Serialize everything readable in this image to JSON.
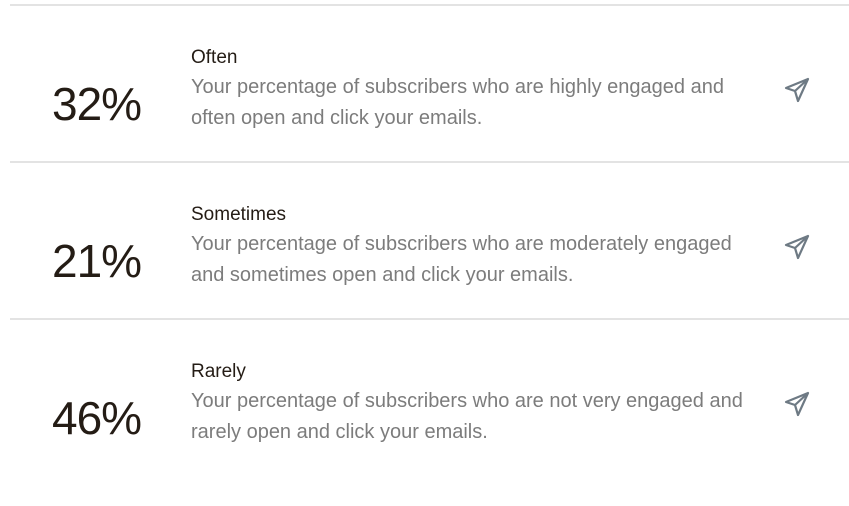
{
  "segments": [
    {
      "percent": "32%",
      "title": "Often",
      "description": "Your percentage of subscribers who are highly engaged and often open and click your emails.",
      "icon": "paper-plane-icon"
    },
    {
      "percent": "21%",
      "title": "Sometimes",
      "description": "Your percentage of subscribers who are moderately engaged and sometimes open and click your emails.",
      "icon": "paper-plane-icon"
    },
    {
      "percent": "46%",
      "title": "Rarely",
      "description": "Your percentage of subscribers who are not very engaged and rarely open and click your emails.",
      "icon": "paper-plane-icon"
    }
  ],
  "colors": {
    "text": "#241c15",
    "muted": "#7c7c7c",
    "divider": "#e3e3e3",
    "icon": "#6e7a84"
  }
}
